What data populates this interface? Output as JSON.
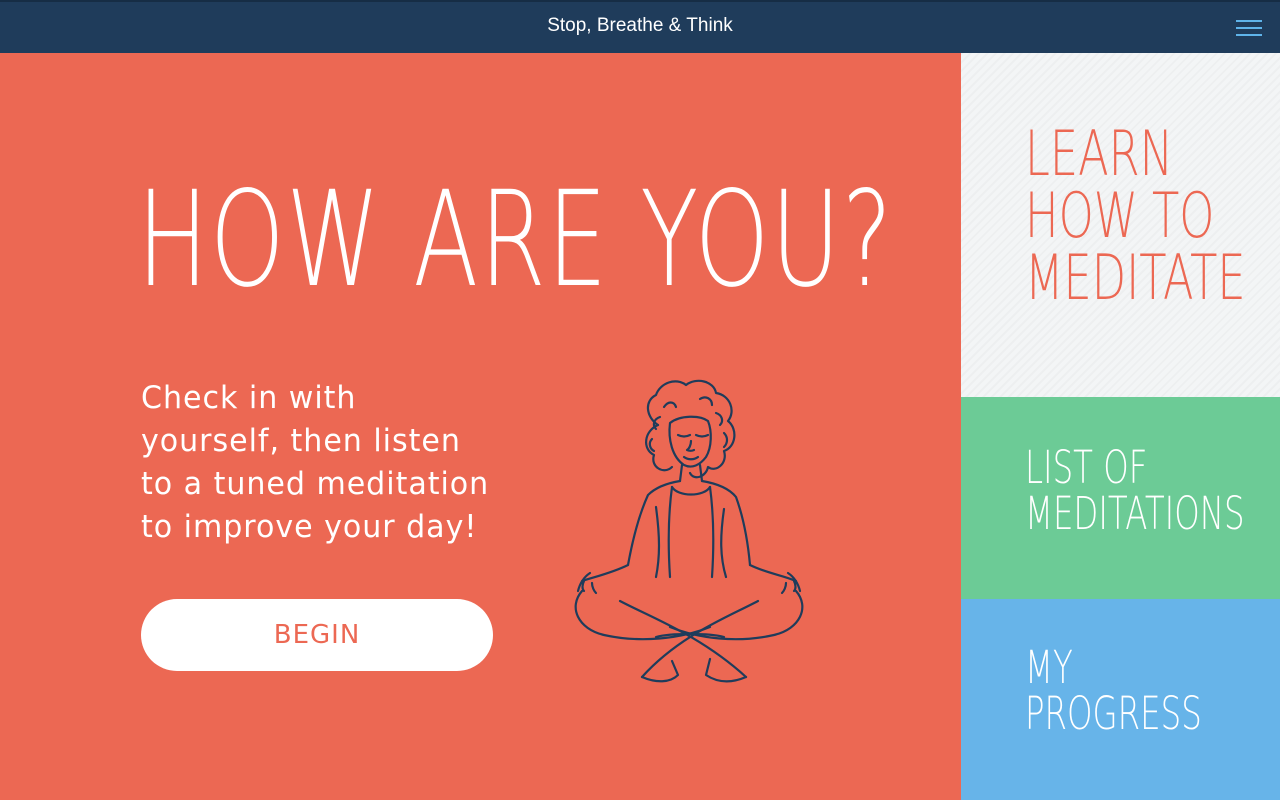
{
  "app": {
    "title": "Stop, Breathe & Think"
  },
  "header": {
    "menu_icon": "hamburger-menu-icon"
  },
  "main": {
    "headline": "HOW ARE YOU?",
    "intro_lines": [
      "Check in with",
      "yourself, then listen",
      "to a tuned meditation",
      "to improve your day!"
    ],
    "begin_label": "BEGIN",
    "illustration_icon": "meditating-person-icon"
  },
  "sidebar": {
    "learn": [
      "LEARN",
      "HOW TO",
      "MEDITATE"
    ],
    "list": [
      "LIST OF",
      "MEDITATIONS"
    ],
    "progress": [
      "MY",
      "PROGRESS"
    ]
  },
  "colors": {
    "header_bg": "#1f3c5b",
    "main_bg": "#ec6853",
    "learn_bg": "#f3f5f6",
    "list_bg": "#6ccb96",
    "progress_bg": "#67b4e9",
    "menu_icon": "#5fb4ea",
    "illustration_ink": "#1f3c5b"
  }
}
